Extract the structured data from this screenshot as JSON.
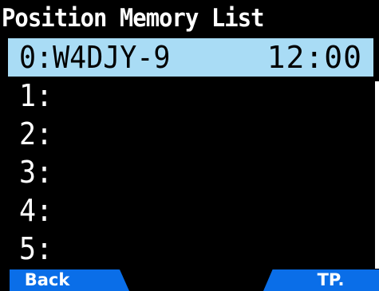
{
  "screen": {
    "title": "Position Memory List"
  },
  "list": {
    "items": [
      {
        "label": "0:W4DJY-9",
        "time": "12:00",
        "selected": true
      },
      {
        "label": "1:",
        "time": "",
        "selected": false
      },
      {
        "label": "2:",
        "time": "",
        "selected": false
      },
      {
        "label": "3:",
        "time": "",
        "selected": false
      },
      {
        "label": "4:",
        "time": "",
        "selected": false
      },
      {
        "label": "5:",
        "time": "",
        "selected": false
      }
    ]
  },
  "softkeys": {
    "left_label": "Back",
    "right_label": "TP."
  },
  "colors": {
    "background": "#000000",
    "selection": "#a9dcf5",
    "softkey": "#0a6ee8",
    "text": "#ffffff"
  }
}
